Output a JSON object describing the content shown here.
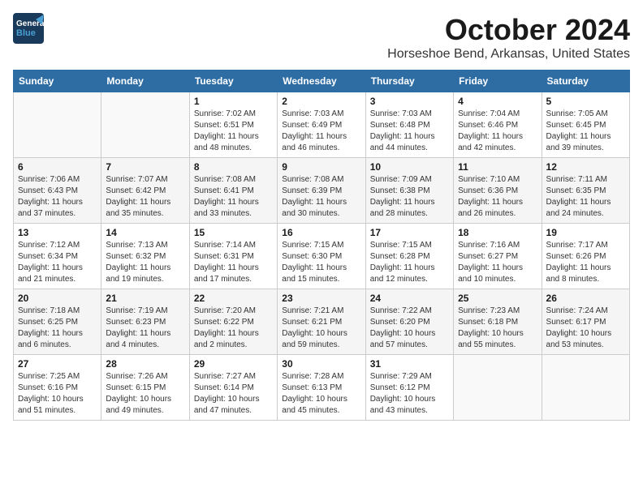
{
  "logo": {
    "line1": "General",
    "line2": "Blue"
  },
  "title": "October 2024",
  "location": "Horseshoe Bend, Arkansas, United States",
  "weekdays": [
    "Sunday",
    "Monday",
    "Tuesday",
    "Wednesday",
    "Thursday",
    "Friday",
    "Saturday"
  ],
  "weeks": [
    [
      {
        "day": "",
        "info": ""
      },
      {
        "day": "",
        "info": ""
      },
      {
        "day": "1",
        "info": "Sunrise: 7:02 AM\nSunset: 6:51 PM\nDaylight: 11 hours and 48 minutes."
      },
      {
        "day": "2",
        "info": "Sunrise: 7:03 AM\nSunset: 6:49 PM\nDaylight: 11 hours and 46 minutes."
      },
      {
        "day": "3",
        "info": "Sunrise: 7:03 AM\nSunset: 6:48 PM\nDaylight: 11 hours and 44 minutes."
      },
      {
        "day": "4",
        "info": "Sunrise: 7:04 AM\nSunset: 6:46 PM\nDaylight: 11 hours and 42 minutes."
      },
      {
        "day": "5",
        "info": "Sunrise: 7:05 AM\nSunset: 6:45 PM\nDaylight: 11 hours and 39 minutes."
      }
    ],
    [
      {
        "day": "6",
        "info": "Sunrise: 7:06 AM\nSunset: 6:43 PM\nDaylight: 11 hours and 37 minutes."
      },
      {
        "day": "7",
        "info": "Sunrise: 7:07 AM\nSunset: 6:42 PM\nDaylight: 11 hours and 35 minutes."
      },
      {
        "day": "8",
        "info": "Sunrise: 7:08 AM\nSunset: 6:41 PM\nDaylight: 11 hours and 33 minutes."
      },
      {
        "day": "9",
        "info": "Sunrise: 7:08 AM\nSunset: 6:39 PM\nDaylight: 11 hours and 30 minutes."
      },
      {
        "day": "10",
        "info": "Sunrise: 7:09 AM\nSunset: 6:38 PM\nDaylight: 11 hours and 28 minutes."
      },
      {
        "day": "11",
        "info": "Sunrise: 7:10 AM\nSunset: 6:36 PM\nDaylight: 11 hours and 26 minutes."
      },
      {
        "day": "12",
        "info": "Sunrise: 7:11 AM\nSunset: 6:35 PM\nDaylight: 11 hours and 24 minutes."
      }
    ],
    [
      {
        "day": "13",
        "info": "Sunrise: 7:12 AM\nSunset: 6:34 PM\nDaylight: 11 hours and 21 minutes."
      },
      {
        "day": "14",
        "info": "Sunrise: 7:13 AM\nSunset: 6:32 PM\nDaylight: 11 hours and 19 minutes."
      },
      {
        "day": "15",
        "info": "Sunrise: 7:14 AM\nSunset: 6:31 PM\nDaylight: 11 hours and 17 minutes."
      },
      {
        "day": "16",
        "info": "Sunrise: 7:15 AM\nSunset: 6:30 PM\nDaylight: 11 hours and 15 minutes."
      },
      {
        "day": "17",
        "info": "Sunrise: 7:15 AM\nSunset: 6:28 PM\nDaylight: 11 hours and 12 minutes."
      },
      {
        "day": "18",
        "info": "Sunrise: 7:16 AM\nSunset: 6:27 PM\nDaylight: 11 hours and 10 minutes."
      },
      {
        "day": "19",
        "info": "Sunrise: 7:17 AM\nSunset: 6:26 PM\nDaylight: 11 hours and 8 minutes."
      }
    ],
    [
      {
        "day": "20",
        "info": "Sunrise: 7:18 AM\nSunset: 6:25 PM\nDaylight: 11 hours and 6 minutes."
      },
      {
        "day": "21",
        "info": "Sunrise: 7:19 AM\nSunset: 6:23 PM\nDaylight: 11 hours and 4 minutes."
      },
      {
        "day": "22",
        "info": "Sunrise: 7:20 AM\nSunset: 6:22 PM\nDaylight: 11 hours and 2 minutes."
      },
      {
        "day": "23",
        "info": "Sunrise: 7:21 AM\nSunset: 6:21 PM\nDaylight: 10 hours and 59 minutes."
      },
      {
        "day": "24",
        "info": "Sunrise: 7:22 AM\nSunset: 6:20 PM\nDaylight: 10 hours and 57 minutes."
      },
      {
        "day": "25",
        "info": "Sunrise: 7:23 AM\nSunset: 6:18 PM\nDaylight: 10 hours and 55 minutes."
      },
      {
        "day": "26",
        "info": "Sunrise: 7:24 AM\nSunset: 6:17 PM\nDaylight: 10 hours and 53 minutes."
      }
    ],
    [
      {
        "day": "27",
        "info": "Sunrise: 7:25 AM\nSunset: 6:16 PM\nDaylight: 10 hours and 51 minutes."
      },
      {
        "day": "28",
        "info": "Sunrise: 7:26 AM\nSunset: 6:15 PM\nDaylight: 10 hours and 49 minutes."
      },
      {
        "day": "29",
        "info": "Sunrise: 7:27 AM\nSunset: 6:14 PM\nDaylight: 10 hours and 47 minutes."
      },
      {
        "day": "30",
        "info": "Sunrise: 7:28 AM\nSunset: 6:13 PM\nDaylight: 10 hours and 45 minutes."
      },
      {
        "day": "31",
        "info": "Sunrise: 7:29 AM\nSunset: 6:12 PM\nDaylight: 10 hours and 43 minutes."
      },
      {
        "day": "",
        "info": ""
      },
      {
        "day": "",
        "info": ""
      }
    ]
  ]
}
